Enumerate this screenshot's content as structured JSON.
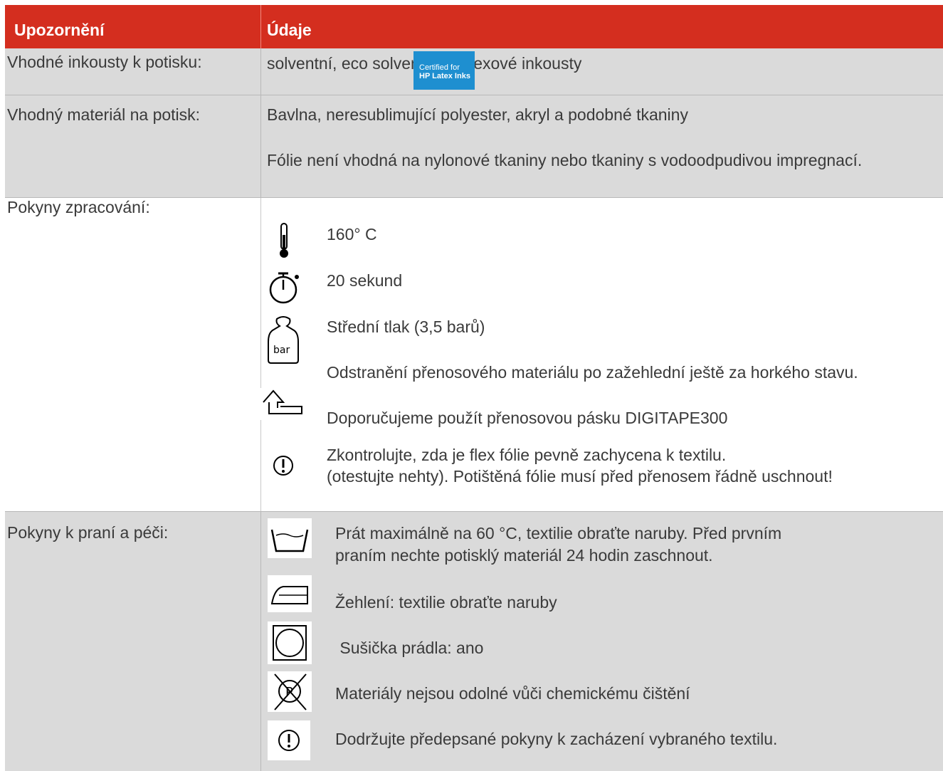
{
  "header": {
    "col1": "Upozornění",
    "col2": "Údaje"
  },
  "rows": {
    "inks": {
      "label": "Vhodné inkousty k potisku:",
      "value": "solventní, eco solventní a latexové inkousty",
      "badge_line1": "Certified for",
      "badge_line2": "HP Latex Inks"
    },
    "material": {
      "label": "Vhodný materiál na potisk:",
      "line1": "Bavlna, neresublimující polyester, akryl a podobné tkaniny",
      "line2": "Fólie není vhodná na nylonové tkaniny nebo tkaniny s vodoodpudivou impregnací."
    },
    "processing": {
      "label": "Pokyny zpracování:",
      "temperature": "160° C",
      "time": "20 sekund",
      "pressure": "Střední tlak (3,5 barů)",
      "bar_icon_text": "bar",
      "removal": "Odstranění přenosového materiálu po zažehlední ještě za horkého stavu.",
      "tape": "Doporučujeme použít přenosovou pásku DIGITAPE300",
      "check1": "Zkontrolujte, zda je flex fólie pevně zachycena k textilu.",
      "check2": "(otestujte nehty). Potištěná fólie musí před přenosem řádně uschnout!"
    },
    "care": {
      "label": "Pokyny k praní a péči:",
      "wash1": "Prát maximálně na 60 °C, textilie obraťte naruby. Před prvním",
      "wash2": "praním nechte potisklý materiál 24 hodin zaschnout.",
      "iron": "Žehlení: textilie obraťte naruby",
      "dryer": " Sušička prádla: ano",
      "dryclean": "Materiály nejsou odolné vůči chemickému čištění",
      "follow": "Dodržujte předepsané pokyny k zacházení vybraného textilu."
    }
  },
  "colors": {
    "header_red": "#d42e1f",
    "row_gray": "#dadada",
    "badge_blue": "#1e8fd0"
  }
}
